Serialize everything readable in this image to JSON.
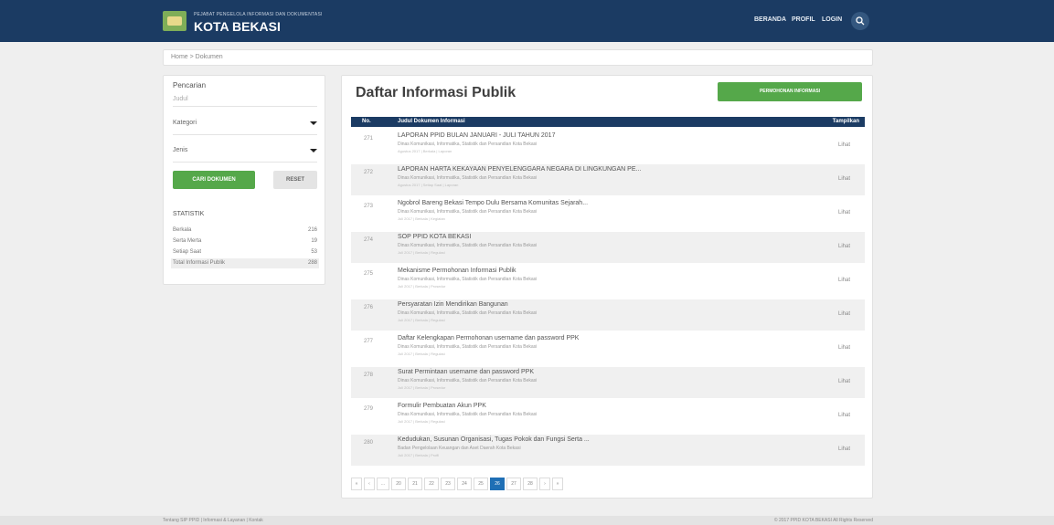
{
  "header": {
    "subtitle": "PEJABAT PENGELOLA INFORMASI DAN DOKUMENTASI",
    "title": "KOTA BEKASI",
    "nav": [
      "BERANDA",
      "PROFIL",
      "LOGIN"
    ],
    "bg_color": "#1b3b63"
  },
  "breadcrumb": "Home > Dokumen",
  "sidebar": {
    "search_title": "Pencarian",
    "search_hint": "Judul",
    "kategori": "Kategori",
    "jenis": "Jenis",
    "search_button": "CARI DOKUMEN",
    "reset_button": "RESET",
    "stats_title": "STATISTIK",
    "stats": [
      {
        "label": "Berkala",
        "value": "216"
      },
      {
        "label": "Serta Merta",
        "value": "19"
      },
      {
        "label": "Setiap Saat",
        "value": "53"
      },
      {
        "label": "Total Informasi Publik",
        "value": "288"
      }
    ]
  },
  "main": {
    "title": "Daftar Informasi Publik",
    "request_button": "PERMOHONAN INFORMASI",
    "columns": [
      "No.",
      "Judul Dokumen Informasi",
      "Tampilkan"
    ],
    "rows": [
      {
        "no": "271",
        "title": "LAPORAN PPID BULAN JANUARI - JULI TAHUN 2017",
        "org": "Dinas Komunikasi, Informatika, Statistik dan Persandian Kota Bekasi",
        "meta": "Agustus 2017 | Berkala | Laporan",
        "action": "Lihat"
      },
      {
        "no": "272",
        "title": "LAPORAN HARTA KEKAYAAN PENYELENGGARA NEGARA DI LINGKUNGAN PE...",
        "org": "Dinas Komunikasi, Informatika, Statistik dan Persandian Kota Bekasi",
        "meta": "Agustus 2017 | Setiap Saat | Laporan",
        "action": "Lihat"
      },
      {
        "no": "273",
        "title": "Ngobrol Bareng Bekasi Tempo Dulu Bersama Komunitas Sejarah...",
        "org": "Dinas Komunikasi, Informatika, Statistik dan Persandian Kota Bekasi",
        "meta": "Juli 2017 | Berkala | Kegiatan",
        "action": "Lihat"
      },
      {
        "no": "274",
        "title": "SOP PPID KOTA BEKASI",
        "org": "Dinas Komunikasi, Informatika, Statistik dan Persandian Kota Bekasi",
        "meta": "Juli 2017 | Berkala | Regulasi",
        "action": "Lihat"
      },
      {
        "no": "275",
        "title": "Mekanisme Permohonan Informasi Publik",
        "org": "Dinas Komunikasi, Informatika, Statistik dan Persandian Kota Bekasi",
        "meta": "Juli 2017 | Berkala | Prosedur",
        "action": "Lihat"
      },
      {
        "no": "276",
        "title": "Persyaratan Izin Mendirikan Bangunan",
        "org": "Dinas Komunikasi, Informatika, Statistik dan Persandian Kota Bekasi",
        "meta": "Juli 2017 | Berkala | Regulasi",
        "action": "Lihat"
      },
      {
        "no": "277",
        "title": "Daftar Kelengkapan Permohonan username dan password PPK",
        "org": "Dinas Komunikasi, Informatika, Statistik dan Persandian Kota Bekasi",
        "meta": "Juli 2017 | Berkala | Regulasi",
        "action": "Lihat"
      },
      {
        "no": "278",
        "title": "Surat Permintaan username dan password PPK",
        "org": "Dinas Komunikasi, Informatika, Statistik dan Persandian Kota Bekasi",
        "meta": "Juli 2017 | Berkala | Prosedur",
        "action": "Lihat"
      },
      {
        "no": "279",
        "title": "Formulir Pembuatan Akun PPK",
        "org": "Dinas Komunikasi, Informatika, Statistik dan Persandian Kota Bekasi",
        "meta": "Juli 2017 | Berkala | Regulasi",
        "action": "Lihat"
      },
      {
        "no": "280",
        "title": "Kedudukan, Susunan Organisasi, Tugas Pokok dan Fungsi Serta ...",
        "org": "Badan Pengelolaan Keuangan dan Aset Daerah Kota Bekasi",
        "meta": "Juli 2017 | Berkala | Profil",
        "action": "Lihat"
      }
    ]
  },
  "pagination": [
    "«",
    "‹",
    "...",
    "20",
    "21",
    "22",
    "23",
    "24",
    "25",
    "26",
    "27",
    "28",
    "›",
    "»"
  ],
  "pagination_active": "26",
  "footer": {
    "left": "Tentang SIP PPID | Informasi & Layanan | Kontak",
    "right": "© 2017 PPID KOTA BEKASI All Rights Reserved"
  },
  "colors": {
    "primary": "#1b3b63",
    "success": "#55a84a",
    "link": "#1f6fb5"
  }
}
